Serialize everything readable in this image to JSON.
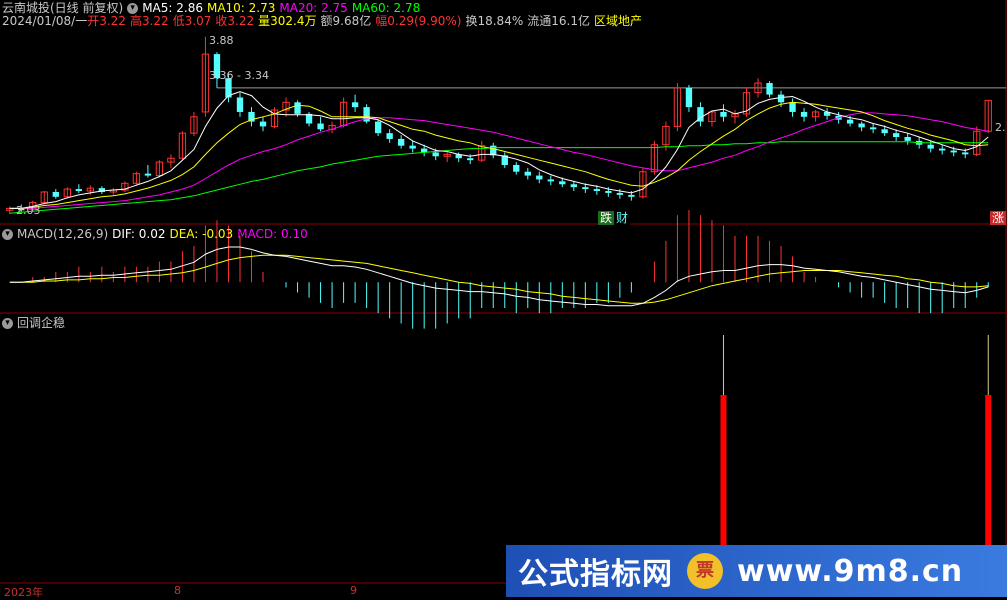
{
  "header": {
    "title": "云南城投(日线 前复权)",
    "ma5": "MA5: 2.86",
    "ma10": "MA10: 2.73",
    "ma20": "MA20: 2.75",
    "ma60": "MA60: 2.78",
    "date": "2024/01/08/一",
    "open": "开3.22",
    "high": "高3.22",
    "low": "低3.07",
    "close": "收3.22",
    "volume": "量302.4万",
    "amount": "额9.68亿",
    "change": "幅0.29(9.90%)",
    "turnover": "换18.84%",
    "float_cap": "流通16.1亿",
    "sector": "区域地产"
  },
  "macd_header": {
    "name": "MACD(12,26,9)",
    "dif": "DIF: 0.02",
    "dea": "DEA: -0.03",
    "macd": "MACD: 0.10"
  },
  "indicator_header": {
    "name": "回调企稳"
  },
  "annotations": {
    "high_label": "3.88",
    "range_label": "3.36 - 3.34",
    "low_label": "2.03",
    "right_label": "2.",
    "badge_die": "跌",
    "badge_cai": "财",
    "badge_zhang": "涨"
  },
  "x_axis_labels": [
    "2023年",
    "8",
    "9"
  ],
  "watermark": {
    "left": "公式指标网",
    "logo": "票",
    "right": "www.9m8.cn"
  },
  "colors": {
    "up": "#ff3232",
    "down": "#54ffff",
    "ma5": "#ffffff",
    "ma10": "#ffff00",
    "ma20": "#ff00ff",
    "ma60": "#00ff00",
    "dif": "#ffffff",
    "dea": "#ffff00",
    "signal": "#ff0000",
    "grid": "#8c0000"
  },
  "chart_data": [
    {
      "type": "candlestick",
      "title": "云南城投(日线 前复权)",
      "ylim": [
        2.0,
        3.95
      ],
      "visible_high": 3.88,
      "visible_low": 2.03,
      "reference_line": 3.35,
      "ohlc": [
        [
          2.08,
          2.12,
          2.04,
          2.1
        ],
        [
          2.1,
          2.14,
          2.06,
          2.08
        ],
        [
          2.09,
          2.18,
          2.07,
          2.16
        ],
        [
          2.16,
          2.28,
          2.14,
          2.27
        ],
        [
          2.27,
          2.3,
          2.2,
          2.22
        ],
        [
          2.22,
          2.32,
          2.2,
          2.3
        ],
        [
          2.3,
          2.35,
          2.26,
          2.28
        ],
        [
          2.28,
          2.34,
          2.24,
          2.31
        ],
        [
          2.31,
          2.33,
          2.25,
          2.27
        ],
        [
          2.27,
          2.31,
          2.24,
          2.29
        ],
        [
          2.29,
          2.38,
          2.27,
          2.36
        ],
        [
          2.36,
          2.48,
          2.34,
          2.46
        ],
        [
          2.46,
          2.55,
          2.42,
          2.44
        ],
        [
          2.44,
          2.6,
          2.42,
          2.58
        ],
        [
          2.58,
          2.66,
          2.52,
          2.62
        ],
        [
          2.62,
          2.9,
          2.6,
          2.88
        ],
        [
          2.88,
          3.1,
          2.85,
          3.05
        ],
        [
          3.1,
          3.88,
          3.05,
          3.7
        ],
        [
          3.7,
          3.72,
          3.35,
          3.45
        ],
        [
          3.45,
          3.5,
          3.2,
          3.25
        ],
        [
          3.25,
          3.3,
          3.05,
          3.1
        ],
        [
          3.1,
          3.15,
          2.95,
          3.0
        ],
        [
          3.0,
          3.05,
          2.9,
          2.95
        ],
        [
          2.95,
          3.15,
          2.93,
          3.12
        ],
        [
          3.12,
          3.25,
          3.05,
          3.2
        ],
        [
          3.2,
          3.22,
          3.05,
          3.08
        ],
        [
          3.08,
          3.1,
          2.95,
          2.98
        ],
        [
          2.98,
          3.05,
          2.9,
          2.92
        ],
        [
          2.92,
          3.0,
          2.88,
          2.96
        ],
        [
          2.96,
          3.25,
          2.94,
          3.2
        ],
        [
          3.2,
          3.28,
          3.1,
          3.15
        ],
        [
          3.15,
          3.18,
          2.98,
          3.0
        ],
        [
          3.0,
          3.02,
          2.85,
          2.88
        ],
        [
          2.88,
          2.92,
          2.78,
          2.82
        ],
        [
          2.82,
          2.86,
          2.72,
          2.75
        ],
        [
          2.75,
          2.8,
          2.68,
          2.72
        ],
        [
          2.72,
          2.76,
          2.64,
          2.68
        ],
        [
          2.68,
          2.72,
          2.6,
          2.64
        ],
        [
          2.64,
          2.7,
          2.58,
          2.66
        ],
        [
          2.66,
          2.68,
          2.58,
          2.62
        ],
        [
          2.62,
          2.66,
          2.56,
          2.6
        ],
        [
          2.6,
          2.8,
          2.58,
          2.75
        ],
        [
          2.75,
          2.78,
          2.62,
          2.65
        ],
        [
          2.65,
          2.68,
          2.52,
          2.55
        ],
        [
          2.55,
          2.58,
          2.45,
          2.48
        ],
        [
          2.48,
          2.52,
          2.4,
          2.44
        ],
        [
          2.44,
          2.48,
          2.36,
          2.4
        ],
        [
          2.4,
          2.44,
          2.34,
          2.38
        ],
        [
          2.38,
          2.42,
          2.32,
          2.35
        ],
        [
          2.35,
          2.38,
          2.28,
          2.32
        ],
        [
          2.32,
          2.36,
          2.26,
          2.3
        ],
        [
          2.3,
          2.34,
          2.24,
          2.28
        ],
        [
          2.28,
          2.32,
          2.22,
          2.26
        ],
        [
          2.26,
          2.3,
          2.2,
          2.24
        ],
        [
          2.24,
          2.28,
          2.18,
          2.22
        ],
        [
          2.22,
          2.52,
          2.2,
          2.48
        ],
        [
          2.48,
          2.8,
          2.45,
          2.76
        ],
        [
          2.76,
          3.0,
          2.7,
          2.95
        ],
        [
          2.95,
          3.4,
          2.9,
          3.35
        ],
        [
          3.35,
          3.38,
          3.1,
          3.15
        ],
        [
          3.15,
          3.2,
          2.95,
          3.0
        ],
        [
          3.0,
          3.12,
          2.95,
          3.1
        ],
        [
          3.1,
          3.18,
          3.0,
          3.05
        ],
        [
          3.05,
          3.12,
          2.98,
          3.08
        ],
        [
          3.08,
          3.35,
          3.05,
          3.3
        ],
        [
          3.3,
          3.45,
          3.25,
          3.4
        ],
        [
          3.4,
          3.42,
          3.25,
          3.28
        ],
        [
          3.28,
          3.32,
          3.15,
          3.2
        ],
        [
          3.2,
          3.24,
          3.05,
          3.1
        ],
        [
          3.1,
          3.14,
          3.0,
          3.05
        ],
        [
          3.05,
          3.12,
          3.0,
          3.1
        ],
        [
          3.1,
          3.14,
          3.02,
          3.06
        ],
        [
          3.06,
          3.1,
          2.98,
          3.02
        ],
        [
          3.02,
          3.06,
          2.95,
          2.98
        ],
        [
          2.98,
          3.0,
          2.9,
          2.94
        ],
        [
          2.94,
          2.98,
          2.88,
          2.92
        ],
        [
          2.92,
          2.96,
          2.85,
          2.88
        ],
        [
          2.88,
          2.92,
          2.8,
          2.84
        ],
        [
          2.84,
          2.88,
          2.76,
          2.8
        ],
        [
          2.8,
          2.84,
          2.72,
          2.76
        ],
        [
          2.76,
          2.8,
          2.68,
          2.72
        ],
        [
          2.72,
          2.76,
          2.66,
          2.7
        ],
        [
          2.7,
          2.74,
          2.64,
          2.68
        ],
        [
          2.68,
          2.72,
          2.62,
          2.66
        ],
        [
          2.66,
          2.95,
          2.64,
          2.9
        ],
        [
          2.9,
          3.22,
          2.88,
          3.22
        ]
      ],
      "ma5": [
        2.1,
        2.1,
        2.12,
        2.15,
        2.17,
        2.21,
        2.24,
        2.26,
        2.28,
        2.29,
        2.3,
        2.34,
        2.38,
        2.43,
        2.49,
        2.6,
        2.71,
        2.95,
        3.14,
        3.27,
        3.31,
        3.27,
        3.15,
        3.08,
        3.07,
        3.07,
        3.07,
        3.06,
        3.03,
        3.03,
        3.04,
        3.04,
        3.02,
        2.96,
        2.88,
        2.8,
        2.75,
        2.7,
        2.69,
        2.66,
        2.64,
        2.66,
        2.66,
        2.64,
        2.61,
        2.57,
        2.5,
        2.45,
        2.41,
        2.38,
        2.35,
        2.33,
        2.3,
        2.28,
        2.26,
        2.3,
        2.4,
        2.53,
        2.71,
        2.94,
        3.04,
        3.11,
        3.13,
        3.08,
        3.11,
        3.19,
        3.23,
        3.25,
        3.26,
        3.21,
        3.15,
        3.1,
        3.07,
        3.04,
        3.02,
        2.98,
        2.95,
        2.91,
        2.88,
        2.84,
        2.8,
        2.76,
        2.72,
        2.7,
        2.74,
        2.84
      ],
      "ma10": [
        2.1,
        2.1,
        2.11,
        2.13,
        2.14,
        2.16,
        2.18,
        2.2,
        2.22,
        2.23,
        2.25,
        2.28,
        2.31,
        2.35,
        2.39,
        2.45,
        2.53,
        2.66,
        2.78,
        2.88,
        2.97,
        3.02,
        3.05,
        3.08,
        3.13,
        3.17,
        3.16,
        3.11,
        3.05,
        3.05,
        3.05,
        3.05,
        3.04,
        3.0,
        2.96,
        2.92,
        2.9,
        2.86,
        2.83,
        2.8,
        2.78,
        2.74,
        2.72,
        2.69,
        2.66,
        2.63,
        2.6,
        2.57,
        2.54,
        2.51,
        2.48,
        2.44,
        2.4,
        2.37,
        2.34,
        2.33,
        2.37,
        2.42,
        2.49,
        2.6,
        2.69,
        2.77,
        2.85,
        2.92,
        3.01,
        3.08,
        3.14,
        3.18,
        3.2,
        3.19,
        3.18,
        3.16,
        3.14,
        3.12,
        3.1,
        3.06,
        3.01,
        2.97,
        2.93,
        2.9,
        2.86,
        2.83,
        2.8,
        2.76,
        2.75,
        2.76
      ],
      "ma20": [
        2.1,
        2.1,
        2.1,
        2.11,
        2.12,
        2.13,
        2.14,
        2.15,
        2.16,
        2.17,
        2.18,
        2.2,
        2.22,
        2.24,
        2.27,
        2.3,
        2.34,
        2.41,
        2.48,
        2.55,
        2.61,
        2.65,
        2.69,
        2.72,
        2.76,
        2.81,
        2.85,
        2.89,
        2.92,
        2.96,
        3.0,
        3.03,
        3.04,
        3.04,
        3.03,
        3.02,
        3.01,
        2.99,
        2.97,
        2.95,
        2.93,
        2.91,
        2.89,
        2.86,
        2.83,
        2.8,
        2.77,
        2.74,
        2.71,
        2.68,
        2.66,
        2.63,
        2.6,
        2.57,
        2.54,
        2.52,
        2.5,
        2.49,
        2.49,
        2.52,
        2.55,
        2.58,
        2.62,
        2.65,
        2.7,
        2.74,
        2.79,
        2.83,
        2.87,
        2.92,
        2.96,
        3.0,
        3.04,
        3.07,
        3.09,
        3.09,
        3.08,
        3.07,
        3.06,
        3.04,
        3.02,
        3.0,
        2.97,
        2.94,
        2.92,
        2.9
      ],
      "ma60": [
        2.05,
        2.06,
        2.07,
        2.08,
        2.09,
        2.1,
        2.11,
        2.12,
        2.13,
        2.14,
        2.15,
        2.16,
        2.17,
        2.18,
        2.19,
        2.21,
        2.23,
        2.26,
        2.29,
        2.32,
        2.35,
        2.38,
        2.4,
        2.43,
        2.46,
        2.49,
        2.51,
        2.53,
        2.56,
        2.58,
        2.6,
        2.62,
        2.64,
        2.65,
        2.66,
        2.67,
        2.68,
        2.69,
        2.7,
        2.71,
        2.72,
        2.72,
        2.73,
        2.73,
        2.73,
        2.73,
        2.73,
        2.73,
        2.73,
        2.73,
        2.73,
        2.73,
        2.73,
        2.73,
        2.73,
        2.73,
        2.73,
        2.74,
        2.74,
        2.75,
        2.75,
        2.76,
        2.76,
        2.77,
        2.77,
        2.78,
        2.78,
        2.79,
        2.79,
        2.79,
        2.79,
        2.79,
        2.79,
        2.79,
        2.79,
        2.79,
        2.79,
        2.79,
        2.79,
        2.78,
        2.78,
        2.78,
        2.78,
        2.78,
        2.78,
        2.78
      ]
    },
    {
      "type": "macd",
      "title": "MACD(12,26,9)",
      "ylim": [
        -0.22,
        0.36
      ],
      "dif": [
        0.0,
        0.0,
        0.01,
        0.02,
        0.03,
        0.04,
        0.05,
        0.05,
        0.06,
        0.06,
        0.07,
        0.08,
        0.09,
        0.1,
        0.11,
        0.14,
        0.17,
        0.24,
        0.28,
        0.3,
        0.3,
        0.28,
        0.25,
        0.23,
        0.22,
        0.2,
        0.18,
        0.16,
        0.14,
        0.14,
        0.13,
        0.11,
        0.08,
        0.05,
        0.02,
        -0.01,
        -0.03,
        -0.05,
        -0.06,
        -0.07,
        -0.08,
        -0.08,
        -0.09,
        -0.1,
        -0.12,
        -0.13,
        -0.15,
        -0.16,
        -0.17,
        -0.18,
        -0.19,
        -0.19,
        -0.2,
        -0.2,
        -0.2,
        -0.18,
        -0.13,
        -0.07,
        0.01,
        0.05,
        0.07,
        0.09,
        0.1,
        0.1,
        0.12,
        0.14,
        0.15,
        0.15,
        0.14,
        0.12,
        0.11,
        0.1,
        0.09,
        0.07,
        0.05,
        0.04,
        0.02,
        0.0,
        -0.02,
        -0.04,
        -0.06,
        -0.07,
        -0.08,
        -0.09,
        -0.07,
        -0.04
      ],
      "dea": [
        0.0,
        0.0,
        0.0,
        0.01,
        0.01,
        0.02,
        0.02,
        0.03,
        0.03,
        0.04,
        0.04,
        0.05,
        0.06,
        0.06,
        0.07,
        0.08,
        0.1,
        0.13,
        0.16,
        0.19,
        0.21,
        0.22,
        0.23,
        0.23,
        0.23,
        0.22,
        0.21,
        0.2,
        0.19,
        0.18,
        0.17,
        0.16,
        0.14,
        0.12,
        0.1,
        0.08,
        0.06,
        0.04,
        0.02,
        0.0,
        -0.01,
        -0.03,
        -0.04,
        -0.05,
        -0.06,
        -0.08,
        -0.09,
        -0.1,
        -0.12,
        -0.13,
        -0.14,
        -0.15,
        -0.16,
        -0.17,
        -0.18,
        -0.18,
        -0.17,
        -0.15,
        -0.12,
        -0.09,
        -0.06,
        -0.03,
        -0.01,
        0.01,
        0.03,
        0.05,
        0.07,
        0.08,
        0.09,
        0.1,
        0.1,
        0.1,
        0.1,
        0.09,
        0.08,
        0.07,
        0.06,
        0.05,
        0.03,
        0.02,
        0.0,
        -0.01,
        -0.03,
        -0.04,
        -0.04,
        -0.03
      ]
    },
    {
      "type": "bar",
      "title": "回调企稳",
      "signal_bars": [
        {
          "index": 62,
          "value": 1.0
        },
        {
          "index": 85,
          "value": 1.0
        }
      ]
    }
  ]
}
